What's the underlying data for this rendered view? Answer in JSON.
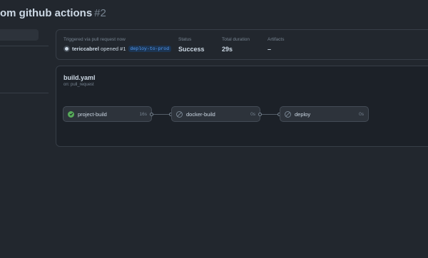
{
  "page": {
    "title": "om github actions",
    "run_number": "#2"
  },
  "summary": {
    "triggered_label": "Triggered via pull request now",
    "actor": "tericcabrel",
    "action": "opened #1",
    "branch": "deploy-to-prod",
    "status_label": "Status",
    "status_value": "Success",
    "duration_label": "Total duration",
    "duration_value": "29s",
    "artifacts_label": "Artifacts",
    "artifacts_value": "–"
  },
  "workflow": {
    "file": "build.yaml",
    "trigger": "on: pull_request",
    "jobs": [
      {
        "name": "project-build",
        "duration": "16s",
        "status": "success",
        "icon": "check-circle-icon"
      },
      {
        "name": "docker-build",
        "duration": "0s",
        "status": "skipped",
        "icon": "skipped-icon"
      },
      {
        "name": "deploy",
        "duration": "0s",
        "status": "skipped",
        "icon": "skipped-icon"
      }
    ]
  },
  "colors": {
    "background": "#22272e",
    "success": "#57ab5a",
    "branch_text": "#539bf5"
  }
}
